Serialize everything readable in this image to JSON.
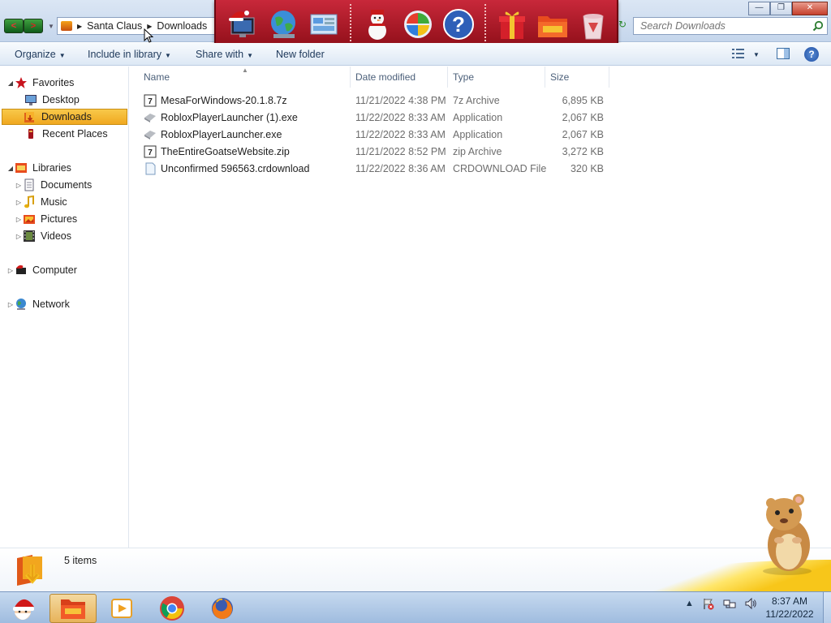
{
  "window": {
    "title": "Downloads",
    "controls": {
      "minimize": "—",
      "maximize": "❐",
      "close": "✕"
    }
  },
  "address": {
    "crumbs": [
      "Santa Claus",
      "Downloads"
    ]
  },
  "search": {
    "placeholder": "Search Downloads"
  },
  "dock": {
    "icons": [
      "computer-santa-icon",
      "globe-icon",
      "control-panel-icon",
      "snowman-icon",
      "windows-logo-icon",
      "help-icon",
      "gift-icon",
      "folder-icon",
      "recycle-bin-icon"
    ],
    "help_glyph": "?"
  },
  "toolbar": {
    "organize": "Organize",
    "include_in_library": "Include in library",
    "share_with": "Share with",
    "new_folder": "New folder",
    "help": "?"
  },
  "nav": {
    "favorites": "Favorites",
    "desktop": "Desktop",
    "downloads": "Downloads",
    "recent_places": "Recent Places",
    "libraries": "Libraries",
    "documents": "Documents",
    "music": "Music",
    "pictures": "Pictures",
    "videos": "Videos",
    "computer": "Computer",
    "network": "Network"
  },
  "columns": {
    "name": "Name",
    "date": "Date modified",
    "type": "Type",
    "size": "Size"
  },
  "files": [
    {
      "name": "MesaForWindows-20.1.8.7z",
      "date": "11/21/2022 4:38 PM",
      "type": "7z Archive",
      "size": "6,895 KB",
      "icon": "archive-icon"
    },
    {
      "name": "RobloxPlayerLauncher (1).exe",
      "date": "11/22/2022 8:33 AM",
      "type": "Application",
      "size": "2,067 KB",
      "icon": "application-icon"
    },
    {
      "name": "RobloxPlayerLauncher.exe",
      "date": "11/22/2022 8:33 AM",
      "type": "Application",
      "size": "2,067 KB",
      "icon": "application-icon"
    },
    {
      "name": "TheEntireGoatseWebsite.zip",
      "date": "11/21/2022 8:52 PM",
      "type": "zip Archive",
      "size": "3,272 KB",
      "icon": "archive-icon"
    },
    {
      "name": "Unconfirmed 596563.crdownload",
      "date": "11/22/2022 8:36 AM",
      "type": "CRDOWNLOAD File",
      "size": "320 KB",
      "icon": "blank-file-icon"
    }
  ],
  "details": {
    "count": "5 items"
  },
  "taskbar": {
    "time": "8:37 AM",
    "date": "11/22/2022",
    "buttons": [
      "start-santa-icon",
      "explorer-icon",
      "media-player-icon",
      "chrome-icon",
      "firefox-icon"
    ]
  }
}
